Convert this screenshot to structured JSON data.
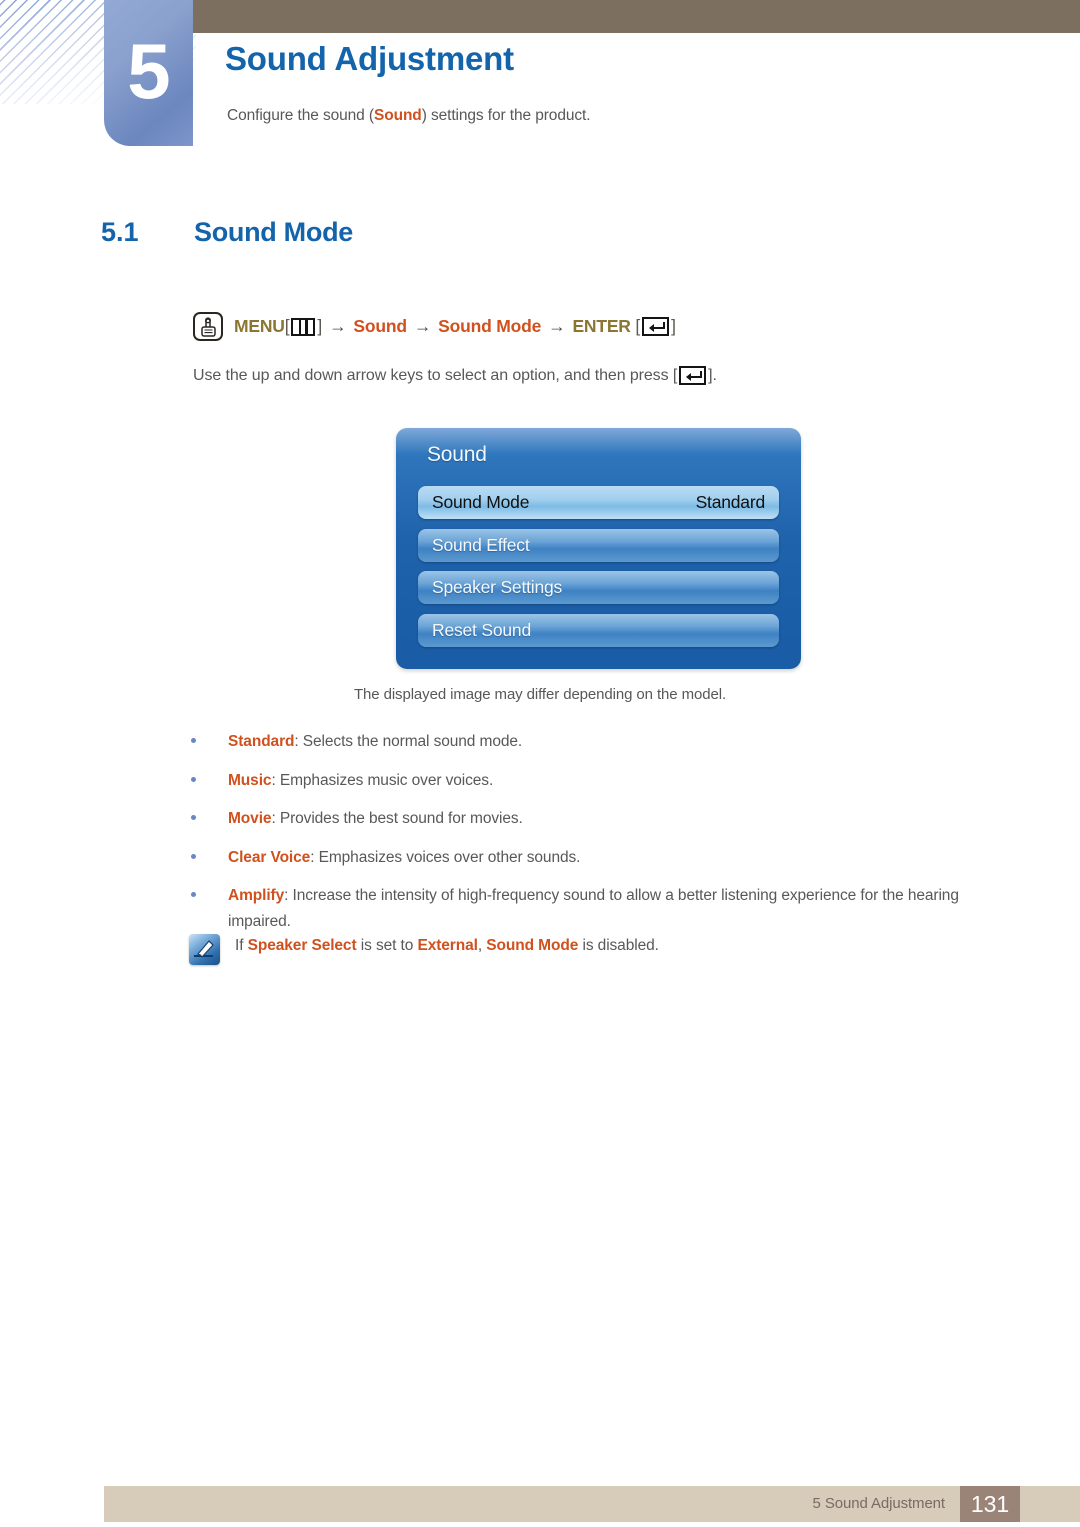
{
  "header": {
    "chapter_number": "5",
    "chapter_title": "Sound Adjustment",
    "chapter_subtitle_pre": "Configure the sound (",
    "chapter_subtitle_highlight": "Sound",
    "chapter_subtitle_post": ") settings for the product."
  },
  "section": {
    "number": "5.1",
    "title": "Sound Mode"
  },
  "menu_path": {
    "menu_label": "MENU",
    "menu_key_icon": "menu-key-icon",
    "hand_icon": "hand-press-icon",
    "arrow": "→",
    "bracket_open": "[",
    "bracket_close": "]",
    "step_sound": "Sound",
    "step_sound_mode": "Sound Mode",
    "enter_label": "ENTER",
    "enter_key_icon": "enter-key-icon"
  },
  "instruction": {
    "text_before": "Use the up and down arrow keys to select an option, and then press [",
    "text_after": "]."
  },
  "osd": {
    "title": "Sound",
    "rows": [
      {
        "label": "Sound Mode",
        "value": "Standard",
        "selected": true
      },
      {
        "label": "Sound Effect",
        "value": "",
        "selected": false
      },
      {
        "label": "Speaker Settings",
        "value": "",
        "selected": false
      },
      {
        "label": "Reset Sound",
        "value": "",
        "selected": false
      }
    ]
  },
  "caption": "The displayed image may differ depending on the model.",
  "bullets": [
    {
      "term": "Standard",
      "desc": ": Selects the normal sound mode."
    },
    {
      "term": "Music",
      "desc": ": Emphasizes music over voices."
    },
    {
      "term": "Movie",
      "desc": ": Provides the best sound for movies."
    },
    {
      "term": "Clear Voice",
      "desc": ": Emphasizes voices over other sounds."
    },
    {
      "term": "Amplify",
      "desc": ": Increase the intensity of high-frequency sound to allow a better listening experience for the hearing impaired."
    }
  ],
  "note": {
    "icon": "note-pen-icon",
    "seg1": "If ",
    "term1": "Speaker Select",
    "seg2": " is set to ",
    "term2": "External",
    "seg3": ", ",
    "term3": "Sound Mode",
    "seg4": " is disabled."
  },
  "footer": {
    "label": "5 Sound Adjustment",
    "page_number": "131"
  },
  "colors": {
    "heading_blue": "#1464ab",
    "term_orange": "#d0511e",
    "menu_olive": "#8a7630",
    "body_grey": "#58585a",
    "header_brown": "#7c6f5f",
    "footer_beige": "#d7cbb9",
    "footer_page_brown": "#9a8377",
    "chapter_block_blue": "#8aa0cd",
    "osd_blue": "#1f63ac"
  }
}
